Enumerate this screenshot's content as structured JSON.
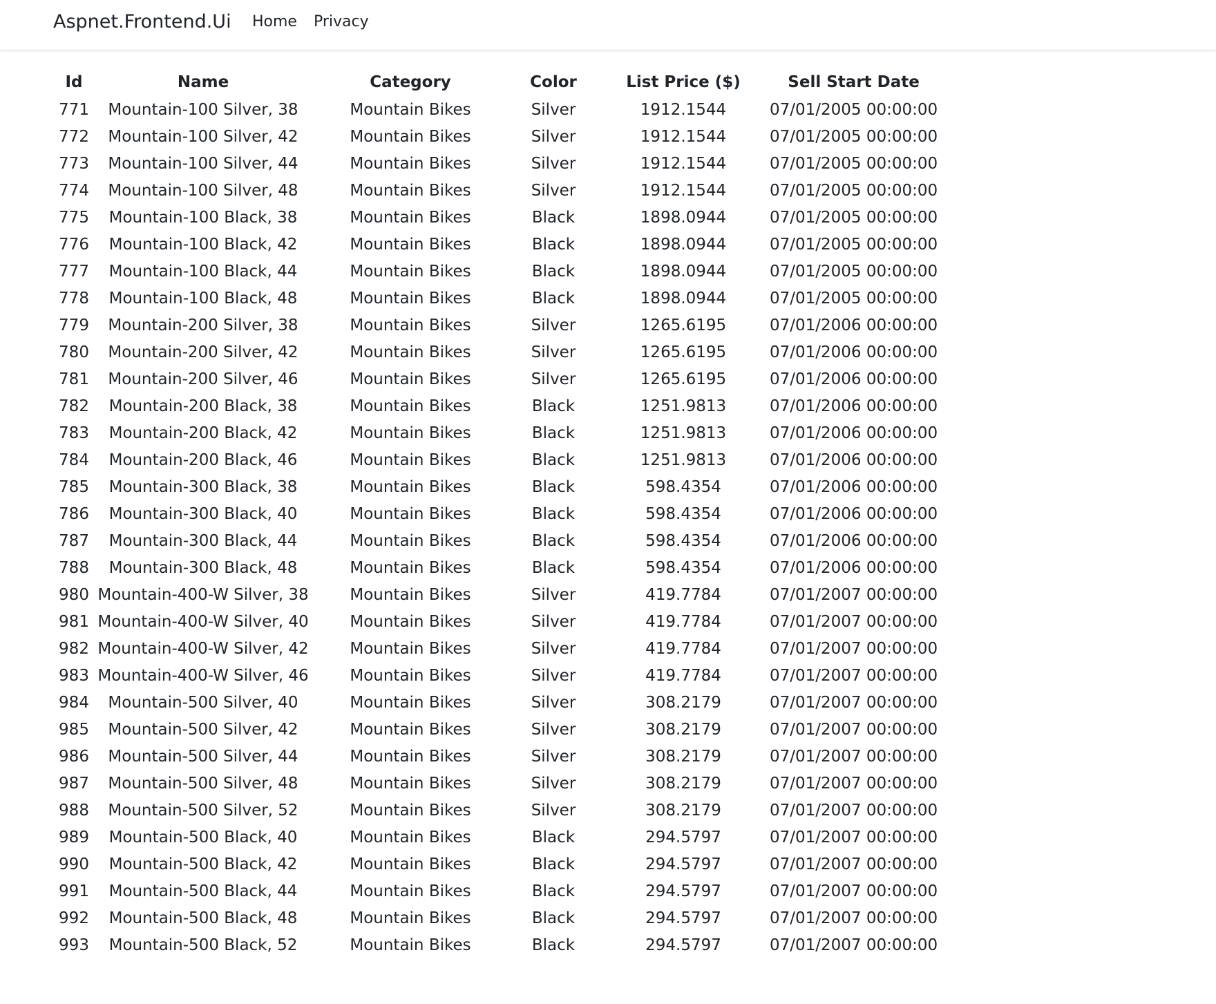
{
  "navbar": {
    "brand": "Aspnet.Frontend.Ui",
    "links": [
      "Home",
      "Privacy"
    ]
  },
  "table": {
    "headers": [
      "Id",
      "Name",
      "Category",
      "Color",
      "List Price ($)",
      "Sell Start Date"
    ],
    "rows": [
      [
        "771",
        "Mountain-100 Silver, 38",
        "Mountain Bikes",
        "Silver",
        "1912.1544",
        "07/01/2005 00:00:00"
      ],
      [
        "772",
        "Mountain-100 Silver, 42",
        "Mountain Bikes",
        "Silver",
        "1912.1544",
        "07/01/2005 00:00:00"
      ],
      [
        "773",
        "Mountain-100 Silver, 44",
        "Mountain Bikes",
        "Silver",
        "1912.1544",
        "07/01/2005 00:00:00"
      ],
      [
        "774",
        "Mountain-100 Silver, 48",
        "Mountain Bikes",
        "Silver",
        "1912.1544",
        "07/01/2005 00:00:00"
      ],
      [
        "775",
        "Mountain-100 Black, 38",
        "Mountain Bikes",
        "Black",
        "1898.0944",
        "07/01/2005 00:00:00"
      ],
      [
        "776",
        "Mountain-100 Black, 42",
        "Mountain Bikes",
        "Black",
        "1898.0944",
        "07/01/2005 00:00:00"
      ],
      [
        "777",
        "Mountain-100 Black, 44",
        "Mountain Bikes",
        "Black",
        "1898.0944",
        "07/01/2005 00:00:00"
      ],
      [
        "778",
        "Mountain-100 Black, 48",
        "Mountain Bikes",
        "Black",
        "1898.0944",
        "07/01/2005 00:00:00"
      ],
      [
        "779",
        "Mountain-200 Silver, 38",
        "Mountain Bikes",
        "Silver",
        "1265.6195",
        "07/01/2006 00:00:00"
      ],
      [
        "780",
        "Mountain-200 Silver, 42",
        "Mountain Bikes",
        "Silver",
        "1265.6195",
        "07/01/2006 00:00:00"
      ],
      [
        "781",
        "Mountain-200 Silver, 46",
        "Mountain Bikes",
        "Silver",
        "1265.6195",
        "07/01/2006 00:00:00"
      ],
      [
        "782",
        "Mountain-200 Black, 38",
        "Mountain Bikes",
        "Black",
        "1251.9813",
        "07/01/2006 00:00:00"
      ],
      [
        "783",
        "Mountain-200 Black, 42",
        "Mountain Bikes",
        "Black",
        "1251.9813",
        "07/01/2006 00:00:00"
      ],
      [
        "784",
        "Mountain-200 Black, 46",
        "Mountain Bikes",
        "Black",
        "1251.9813",
        "07/01/2006 00:00:00"
      ],
      [
        "785",
        "Mountain-300 Black, 38",
        "Mountain Bikes",
        "Black",
        "598.4354",
        "07/01/2006 00:00:00"
      ],
      [
        "786",
        "Mountain-300 Black, 40",
        "Mountain Bikes",
        "Black",
        "598.4354",
        "07/01/2006 00:00:00"
      ],
      [
        "787",
        "Mountain-300 Black, 44",
        "Mountain Bikes",
        "Black",
        "598.4354",
        "07/01/2006 00:00:00"
      ],
      [
        "788",
        "Mountain-300 Black, 48",
        "Mountain Bikes",
        "Black",
        "598.4354",
        "07/01/2006 00:00:00"
      ],
      [
        "980",
        "Mountain-400-W Silver, 38",
        "Mountain Bikes",
        "Silver",
        "419.7784",
        "07/01/2007 00:00:00"
      ],
      [
        "981",
        "Mountain-400-W Silver, 40",
        "Mountain Bikes",
        "Silver",
        "419.7784",
        "07/01/2007 00:00:00"
      ],
      [
        "982",
        "Mountain-400-W Silver, 42",
        "Mountain Bikes",
        "Silver",
        "419.7784",
        "07/01/2007 00:00:00"
      ],
      [
        "983",
        "Mountain-400-W Silver, 46",
        "Mountain Bikes",
        "Silver",
        "419.7784",
        "07/01/2007 00:00:00"
      ],
      [
        "984",
        "Mountain-500 Silver, 40",
        "Mountain Bikes",
        "Silver",
        "308.2179",
        "07/01/2007 00:00:00"
      ],
      [
        "985",
        "Mountain-500 Silver, 42",
        "Mountain Bikes",
        "Silver",
        "308.2179",
        "07/01/2007 00:00:00"
      ],
      [
        "986",
        "Mountain-500 Silver, 44",
        "Mountain Bikes",
        "Silver",
        "308.2179",
        "07/01/2007 00:00:00"
      ],
      [
        "987",
        "Mountain-500 Silver, 48",
        "Mountain Bikes",
        "Silver",
        "308.2179",
        "07/01/2007 00:00:00"
      ],
      [
        "988",
        "Mountain-500 Silver, 52",
        "Mountain Bikes",
        "Silver",
        "308.2179",
        "07/01/2007 00:00:00"
      ],
      [
        "989",
        "Mountain-500 Black, 40",
        "Mountain Bikes",
        "Black",
        "294.5797",
        "07/01/2007 00:00:00"
      ],
      [
        "990",
        "Mountain-500 Black, 42",
        "Mountain Bikes",
        "Black",
        "294.5797",
        "07/01/2007 00:00:00"
      ],
      [
        "991",
        "Mountain-500 Black, 44",
        "Mountain Bikes",
        "Black",
        "294.5797",
        "07/01/2007 00:00:00"
      ],
      [
        "992",
        "Mountain-500 Black, 48",
        "Mountain Bikes",
        "Black",
        "294.5797",
        "07/01/2007 00:00:00"
      ],
      [
        "993",
        "Mountain-500 Black, 52",
        "Mountain Bikes",
        "Black",
        "294.5797",
        "07/01/2007 00:00:00"
      ]
    ]
  }
}
